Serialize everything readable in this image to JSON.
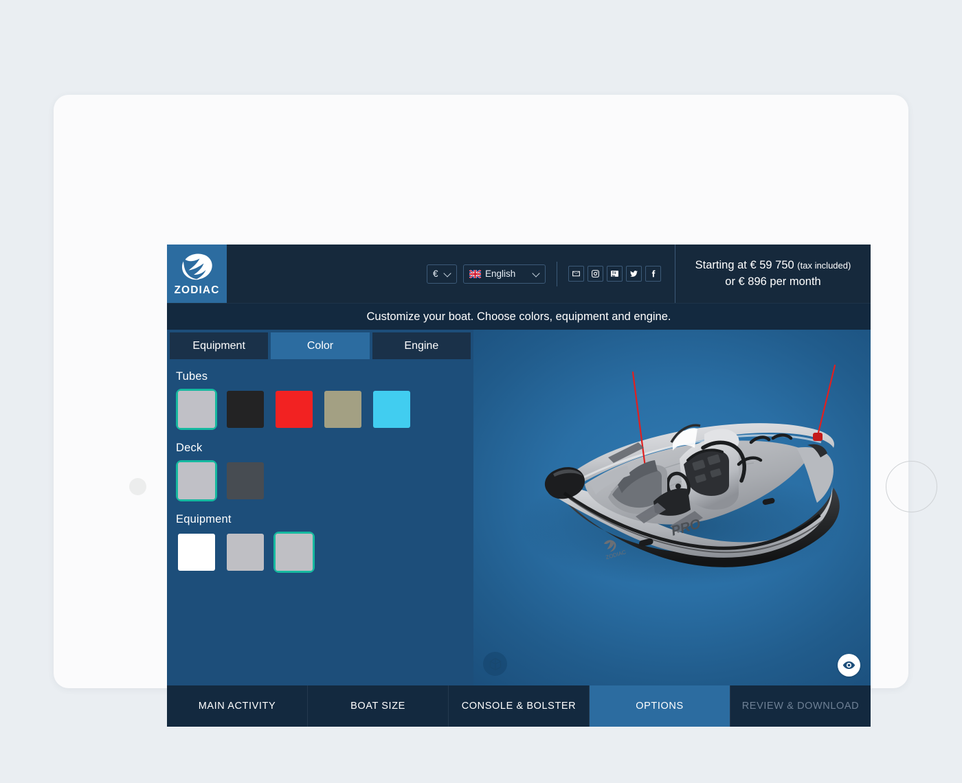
{
  "brand": {
    "wordmark": "ZODIAC",
    "logo_icon": "zodiac-swoosh-icon",
    "logo_bg": "#2c6ca0"
  },
  "header": {
    "currency": {
      "value": "€",
      "icon": "chevron-down-icon"
    },
    "language": {
      "value": "English",
      "flag": "uk-flag-icon",
      "icon": "chevron-down-icon"
    },
    "social": [
      {
        "name": "email-icon",
        "label": "Email"
      },
      {
        "name": "instagram-icon",
        "label": "Instagram"
      },
      {
        "name": "youtube-icon",
        "label": "YouTube"
      },
      {
        "name": "twitter-icon",
        "label": "Twitter"
      },
      {
        "name": "facebook-icon",
        "label": "Facebook"
      }
    ],
    "price": {
      "line1_main": "Starting at € 59 750",
      "line1_note": "(tax included)",
      "line2": "or € 896 per month"
    }
  },
  "instruction": "Customize your boat. Choose colors, equipment and engine.",
  "tabs": [
    {
      "label": "Equipment",
      "active": false
    },
    {
      "label": "Color",
      "active": true
    },
    {
      "label": "Engine",
      "active": false
    }
  ],
  "option_groups": [
    {
      "label": "Tubes",
      "swatches": [
        {
          "color": "#c0c0c6",
          "selected": true
        },
        {
          "color": "#232324",
          "selected": false
        },
        {
          "color": "#f22222",
          "selected": false
        },
        {
          "color": "#a3a083",
          "selected": false
        },
        {
          "color": "#41cdf0",
          "selected": false
        }
      ]
    },
    {
      "label": "Deck",
      "swatches": [
        {
          "color": "#c0c0c6",
          "selected": true
        },
        {
          "color": "#474c52",
          "selected": false
        }
      ]
    },
    {
      "label": "Equipment",
      "swatches": [
        {
          "color": "#ffffff",
          "selected": false
        },
        {
          "color": "#bfbfc4",
          "selected": false
        },
        {
          "color": "#bfbfc4",
          "selected": true
        }
      ]
    }
  ],
  "viewer": {
    "cube_icon": "cube-3d-icon",
    "eye_icon": "eye-icon",
    "boat_hull_label": "PRO",
    "boat_brand_label": "ZODIAC",
    "background_color": "#2a6fa5"
  },
  "bottom_nav": [
    {
      "label": "MAIN ACTIVITY",
      "active": false,
      "disabled": false
    },
    {
      "label": "BOAT SIZE",
      "active": false,
      "disabled": false
    },
    {
      "label": "CONSOLE & BOLSTER",
      "active": false,
      "disabled": false
    },
    {
      "label": "OPTIONS",
      "active": true,
      "disabled": false
    },
    {
      "label": "REVIEW & DOWNLOAD",
      "active": false,
      "disabled": true
    }
  ],
  "colors": {
    "accent": "#2c6ca0",
    "selected_border": "#16b9a0",
    "dark_navy": "#13293f",
    "sidebar_blue": "#1d4e7a"
  }
}
